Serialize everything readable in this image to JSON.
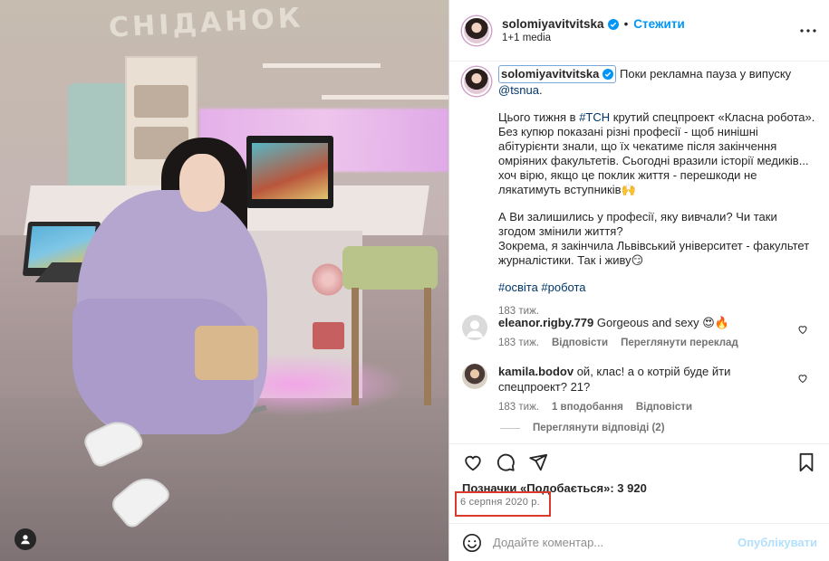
{
  "photo": {
    "alt": "Woman in lavender lace dress sitting on a stool in a TV studio kitchen",
    "sign_text": "СНІДАНОК",
    "icon": "user-tag-icon"
  },
  "header": {
    "username": "solomiyavitvitska",
    "verified_icon": "verified-badge-icon",
    "separator": "•",
    "follow_label": "Стежити",
    "subtitle": "1+1 media",
    "more_icon": "more-horizontal-icon"
  },
  "caption": {
    "username": "solomiyavitvitska",
    "intro": "Поки рекламна пауза у випуску",
    "mention": "@tsnua",
    "mention_suffix": ".",
    "p2_before": "Цього тижня в",
    "p2_hashtag": "#ТСН",
    "p2_after": "крутий спецпроект «Класна робота». Без купюр показані різні професії - щоб нинішні абітурієнти знали, що їх чекатиме після закінчення омріяних факультетів. Сьогодні вразили історії медиків... хоч вірю, якщо це поклик життя - перешкоди не лякатимуть вступників🙌",
    "p3_line1": "А Ви залишились у професії, яку вивчали? Чи таки згодом змінили життя?",
    "p3_line2": "Зокрема, я закінчила Львівський університет - факультет журналістики. Так і живу😏",
    "hashtags": "#освіта #робота",
    "time": "183 тиж."
  },
  "comments": [
    {
      "username": "eleanor.rigby.779",
      "text": "Gorgeous and sexy 😍🔥",
      "time": "183 тиж.",
      "likes": "",
      "reply": "Відповісти",
      "translate": "Переглянути переклад"
    },
    {
      "username": "kamila.bodov",
      "text": "ой, клас! а о котрій буде йти спецпроект? 21?",
      "time": "183 тиж.",
      "likes": "1 вподобання",
      "reply": "Відповісти",
      "translate": ""
    }
  ],
  "view_replies": "Переглянути відповіді (2)",
  "actions": {
    "like_icon": "heart-icon",
    "comment_icon": "comment-icon",
    "share_icon": "send-icon",
    "save_icon": "bookmark-icon"
  },
  "likes_text": "Позначки «Подобається»: 3 920",
  "date": "6 серпня 2020 р.",
  "highlight_color": "#d93a2b",
  "comment_box": {
    "emoji_icon": "emoji-icon",
    "placeholder": "Додайте коментар...",
    "publish": "Опублікувати"
  },
  "colors": {
    "accent": "#0095f6",
    "link": "#00376b",
    "muted": "#737373"
  }
}
